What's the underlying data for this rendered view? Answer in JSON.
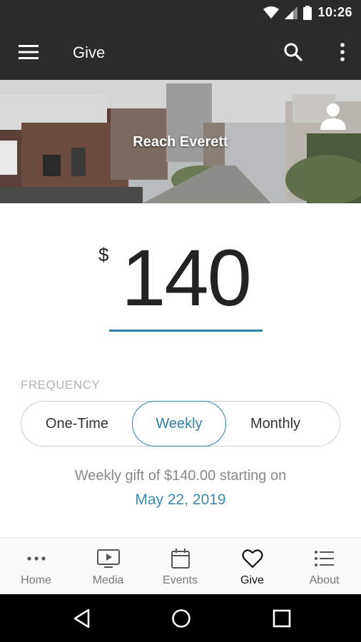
{
  "status_bar": {
    "time": "10:26",
    "icons": [
      "wifi-icon",
      "signal-icon",
      "battery-icon"
    ]
  },
  "app_bar": {
    "title": "Give",
    "icons": [
      "menu-icon",
      "search-icon",
      "more-vert-icon"
    ]
  },
  "banner": {
    "organization": "Reach Everett",
    "icon": "profile-icon"
  },
  "donation": {
    "currency_symbol": "$",
    "amount": "140"
  },
  "frequency": {
    "label": "FREQUENCY",
    "options": [
      "One-Time",
      "Weekly",
      "Monthly"
    ],
    "selected": "Weekly"
  },
  "summary": {
    "text": "Weekly gift of $140.00 starting on",
    "date": "May 22, 2019"
  },
  "bottom_nav": {
    "items": [
      {
        "label": "Home",
        "icon": "more-horiz-icon"
      },
      {
        "label": "Media",
        "icon": "tv-play-icon"
      },
      {
        "label": "Events",
        "icon": "calendar-icon"
      },
      {
        "label": "Give",
        "icon": "heart-icon"
      },
      {
        "label": "About",
        "icon": "list-icon"
      }
    ],
    "active": "Give"
  },
  "system_nav": {
    "icons": [
      "back-icon",
      "home-circle-icon",
      "recents-icon"
    ]
  },
  "colors": {
    "accent": "#2f7fa6",
    "appbar": "#2b2b2b",
    "muted": "#b3b3b3"
  }
}
